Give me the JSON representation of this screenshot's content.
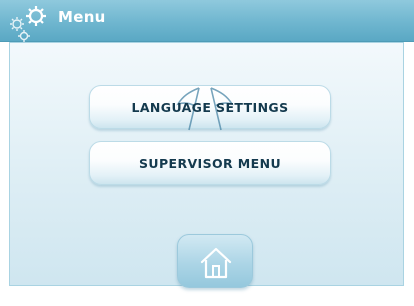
{
  "header": {
    "title": "Menu",
    "icon": "gear-icon"
  },
  "menu": {
    "items": [
      {
        "label": "LANGUAGE SETTINGS",
        "icon": "flags-icon"
      },
      {
        "label": "SUPERVISOR MENU"
      }
    ]
  },
  "footer": {
    "home_icon": "home-icon"
  },
  "colors": {
    "header": "#6fb6cf",
    "panel_border": "#a9d3e2",
    "button_text": "#143a4e",
    "home_button": "#acd5e6"
  }
}
